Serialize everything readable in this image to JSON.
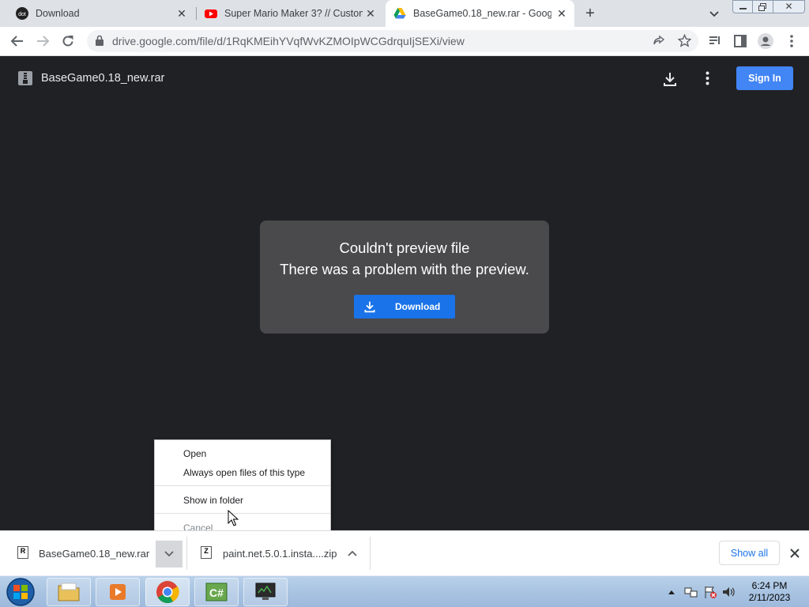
{
  "tabs": [
    {
      "title": "Download",
      "favicon": "dot-icon"
    },
    {
      "title": "Super Mario Maker 3? // Custom",
      "favicon": "youtube-icon"
    },
    {
      "title": "BaseGame0.18_new.rar - Google",
      "favicon": "google-drive-icon",
      "active": true
    }
  ],
  "address_bar": {
    "url": "drive.google.com/file/d/1RqKMEihYVqfWvKZMOIpWCGdrquIjSEXi/view"
  },
  "drive": {
    "file_name": "BaseGame0.18_new.rar",
    "sign_in_label": "Sign In"
  },
  "preview": {
    "title": "Couldn't preview file",
    "message": "There was a problem with the preview.",
    "download_label": "Download"
  },
  "context_menu": {
    "items": [
      "Open",
      "Always open files of this type",
      "Show in folder",
      "Cancel"
    ]
  },
  "download_shelf": {
    "items": [
      {
        "name": "BaseGame0.18_new.rar",
        "type_glyph": "R"
      },
      {
        "name": "paint.net.5.0.1.insta....zip",
        "type_glyph": "Z"
      }
    ],
    "show_all_label": "Show all"
  },
  "taskbar": {
    "time": "6:24 PM",
    "date": "2/11/2023"
  },
  "colors": {
    "accent": "#1a73e8",
    "signin": "#4285f4",
    "viewer_bg": "#202124",
    "card_bg": "#4a4a4c"
  }
}
